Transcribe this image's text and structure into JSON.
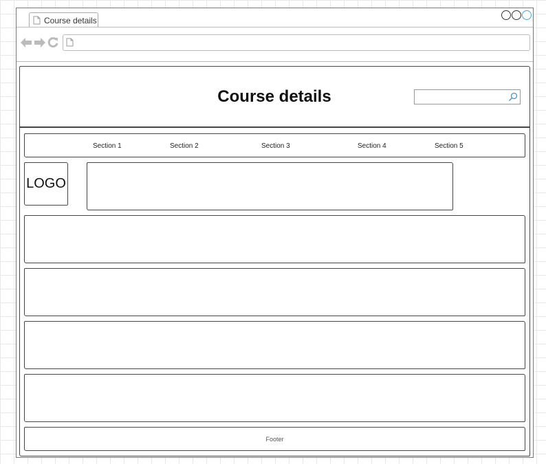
{
  "browser": {
    "tab_title": "Course details",
    "address_bar": {
      "value": ""
    }
  },
  "page": {
    "title": "Course details",
    "search": {
      "value": "",
      "placeholder": ""
    },
    "nav": [
      {
        "label": "Section 1"
      },
      {
        "label": "Section 2"
      },
      {
        "label": "Section 3"
      },
      {
        "label": "Section 4"
      },
      {
        "label": "Section 5"
      }
    ],
    "logo": "LOGO",
    "footer": "Footer"
  },
  "icons": {
    "back": "back-arrow-icon",
    "forward": "forward-arrow-icon",
    "reload": "reload-icon",
    "page": "page-icon",
    "search": "magnifier-icon"
  },
  "colors": {
    "window_control_accent": "#4aa3d8",
    "sketch_stroke": "#444444",
    "nav_icon_gray": "#bbbbbb"
  }
}
